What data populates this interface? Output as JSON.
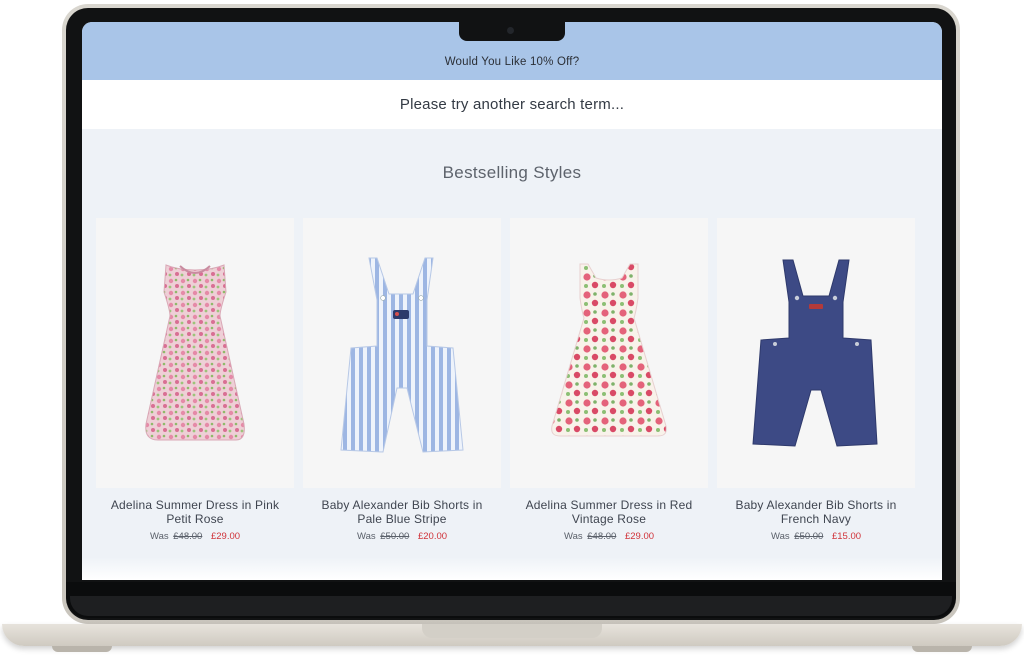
{
  "promo": {
    "text": "Would You Like 10% Off?"
  },
  "search": {
    "message": "Please try another search term..."
  },
  "section": {
    "title": "Bestselling Styles"
  },
  "products": [
    {
      "name": "Adelina Summer Dress in Pink Petit Rose",
      "was_label": "Was",
      "old_price": "£48.00",
      "price": "£29.00",
      "image": "pink-floral-dress"
    },
    {
      "name": "Baby Alexander Bib Shorts in Pale Blue Stripe",
      "was_label": "Was",
      "old_price": "£50.00",
      "price": "£20.00",
      "image": "blue-stripe-bib-shorts"
    },
    {
      "name": "Adelina Summer Dress in Red Vintage Rose",
      "was_label": "Was",
      "old_price": "£48.00",
      "price": "£29.00",
      "image": "red-rose-dress"
    },
    {
      "name": "Baby Alexander Bib Shorts in French Navy",
      "was_label": "Was",
      "old_price": "£50.00",
      "price": "£15.00",
      "image": "navy-bib-shorts"
    }
  ],
  "colors": {
    "promo_bar": "#a9c5e8",
    "sale_price": "#d0333a",
    "page_bg": "#eef2f7",
    "navy": "#3d4a85",
    "stripe_blue": "#9db6e3"
  }
}
